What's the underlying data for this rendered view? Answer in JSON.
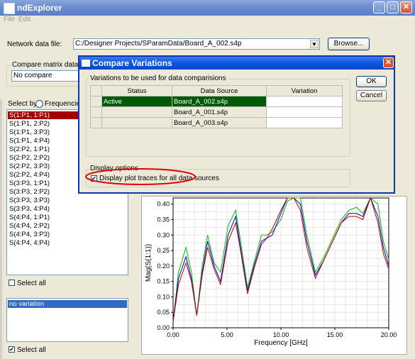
{
  "window": {
    "title": "ndExplorer",
    "menu": [
      "File",
      "Edit"
    ]
  },
  "network": {
    "label": "Network data file:",
    "value": "C:/Designer Projects/SParamData/Board_A_002.s4p",
    "browse_label": "Browse..."
  },
  "compare": {
    "group_label": "Compare matrix data",
    "value": "No compare"
  },
  "select_by": {
    "label": "Select by:",
    "option": "Frequencies"
  },
  "sparams": [
    "S(1:P1, 1:P1)",
    "S(1:P1, 2:P2)",
    "S(1:P1, 3:P3)",
    "S(1:P1, 4:P4)",
    "S(2:P2, 1:P1)",
    "S(2:P2, 2:P2)",
    "S(2:P2, 3:P3)",
    "S(2:P2, 4:P4)",
    "S(3:P3, 1:P1)",
    "S(3:P3, 2:P2)",
    "S(3:P3, 3:P3)",
    "S(3:P3, 4:P4)",
    "S(4:P4, 1:P1)",
    "S(4:P4, 2:P2)",
    "S(4:P4, 3:P3)",
    "S(4:P4, 4:P4)"
  ],
  "select_all_1": "Select all",
  "variation_list": [
    "no variation"
  ],
  "select_all_2": "Select all",
  "dialog": {
    "title": "Compare Variations",
    "group_label": "Variations to be used for data comparisions",
    "columns": [
      "Status",
      "Data Source",
      "Variation"
    ],
    "rows": [
      {
        "status": "Active",
        "source": "Board_A_002.s4p",
        "variation": ""
      },
      {
        "status": "",
        "source": "Board_A_001.s4p",
        "variation": ""
      },
      {
        "status": "",
        "source": "Board_A_003.s4p",
        "variation": ""
      }
    ],
    "ok_label": "OK",
    "cancel_label": "Cancel",
    "display_group": "Display options",
    "display_checkbox": "Display plot traces for all data sources"
  },
  "colors": {
    "selected_item": "#a30000",
    "active_row": "#005a00",
    "list_selection": "#316ac5",
    "annotation_ellipse": "#e00000"
  },
  "chart_data": {
    "type": "line",
    "xlabel": "Frequency [GHz]",
    "ylabel": "Mag(S(1:1))",
    "xticks": [
      "0.00",
      "5.00",
      "10.00",
      "15.00",
      "20.00"
    ],
    "yticks": [
      "0.00",
      "0.05",
      "0.10",
      "0.15",
      "0.20",
      "0.25",
      "0.30",
      "0.35",
      "0.40"
    ],
    "xlim": [
      0,
      20
    ],
    "ylim": [
      0,
      0.42
    ],
    "series": [
      {
        "color": "#00c000",
        "points": [
          [
            0,
            0.02
          ],
          [
            0.5,
            0.18
          ],
          [
            1.2,
            0.26
          ],
          [
            1.7,
            0.18
          ],
          [
            2.2,
            0.04
          ],
          [
            2.7,
            0.2
          ],
          [
            3.2,
            0.3
          ],
          [
            3.8,
            0.21
          ],
          [
            4.4,
            0.18
          ],
          [
            5.1,
            0.33
          ],
          [
            5.8,
            0.38
          ],
          [
            6.3,
            0.27
          ],
          [
            6.9,
            0.13
          ],
          [
            7.5,
            0.21
          ],
          [
            8.2,
            0.3
          ],
          [
            8.7,
            0.3
          ],
          [
            9.2,
            0.31
          ],
          [
            10.0,
            0.35
          ],
          [
            10.6,
            0.41
          ],
          [
            11.2,
            0.42
          ],
          [
            11.8,
            0.42
          ],
          [
            12.4,
            0.3
          ],
          [
            13.2,
            0.18
          ],
          [
            14.0,
            0.23
          ],
          [
            14.8,
            0.29
          ],
          [
            15.6,
            0.35
          ],
          [
            16.3,
            0.38
          ],
          [
            17.0,
            0.39
          ],
          [
            17.6,
            0.37
          ],
          [
            18.3,
            0.42
          ],
          [
            19.0,
            0.4
          ],
          [
            19.5,
            0.28
          ],
          [
            20.0,
            0.22
          ]
        ]
      },
      {
        "color": "#0000d0",
        "points": [
          [
            0,
            0.02
          ],
          [
            0.5,
            0.16
          ],
          [
            1.2,
            0.23
          ],
          [
            1.7,
            0.16
          ],
          [
            2.2,
            0.04
          ],
          [
            2.7,
            0.18
          ],
          [
            3.2,
            0.28
          ],
          [
            3.8,
            0.2
          ],
          [
            4.4,
            0.15
          ],
          [
            5.1,
            0.3
          ],
          [
            5.8,
            0.36
          ],
          [
            6.3,
            0.25
          ],
          [
            6.9,
            0.12
          ],
          [
            7.5,
            0.2
          ],
          [
            8.2,
            0.28
          ],
          [
            8.7,
            0.29
          ],
          [
            9.2,
            0.3
          ],
          [
            10.0,
            0.37
          ],
          [
            10.6,
            0.42
          ],
          [
            11.2,
            0.42
          ],
          [
            11.8,
            0.4
          ],
          [
            12.4,
            0.28
          ],
          [
            13.2,
            0.17
          ],
          [
            14.0,
            0.22
          ],
          [
            14.8,
            0.28
          ],
          [
            15.6,
            0.34
          ],
          [
            16.3,
            0.37
          ],
          [
            17.0,
            0.37
          ],
          [
            17.6,
            0.36
          ],
          [
            18.3,
            0.42
          ],
          [
            19.0,
            0.36
          ],
          [
            19.5,
            0.26
          ],
          [
            20.0,
            0.2
          ]
        ]
      },
      {
        "color": "#c00000",
        "points": [
          [
            0,
            0.02
          ],
          [
            0.5,
            0.14
          ],
          [
            1.2,
            0.21
          ],
          [
            1.7,
            0.15
          ],
          [
            2.2,
            0.04
          ],
          [
            2.7,
            0.17
          ],
          [
            3.2,
            0.26
          ],
          [
            3.8,
            0.19
          ],
          [
            4.4,
            0.14
          ],
          [
            5.1,
            0.28
          ],
          [
            5.8,
            0.34
          ],
          [
            6.3,
            0.24
          ],
          [
            6.9,
            0.11
          ],
          [
            7.5,
            0.19
          ],
          [
            8.2,
            0.27
          ],
          [
            8.7,
            0.29
          ],
          [
            9.2,
            0.32
          ],
          [
            10.0,
            0.38
          ],
          [
            10.6,
            0.42
          ],
          [
            11.2,
            0.42
          ],
          [
            11.8,
            0.38
          ],
          [
            12.4,
            0.26
          ],
          [
            13.2,
            0.16
          ],
          [
            14.0,
            0.22
          ],
          [
            14.8,
            0.28
          ],
          [
            15.6,
            0.34
          ],
          [
            16.3,
            0.36
          ],
          [
            17.0,
            0.36
          ],
          [
            17.6,
            0.35
          ],
          [
            18.3,
            0.42
          ],
          [
            19.0,
            0.34
          ],
          [
            19.5,
            0.24
          ],
          [
            20.0,
            0.19
          ]
        ]
      }
    ]
  }
}
